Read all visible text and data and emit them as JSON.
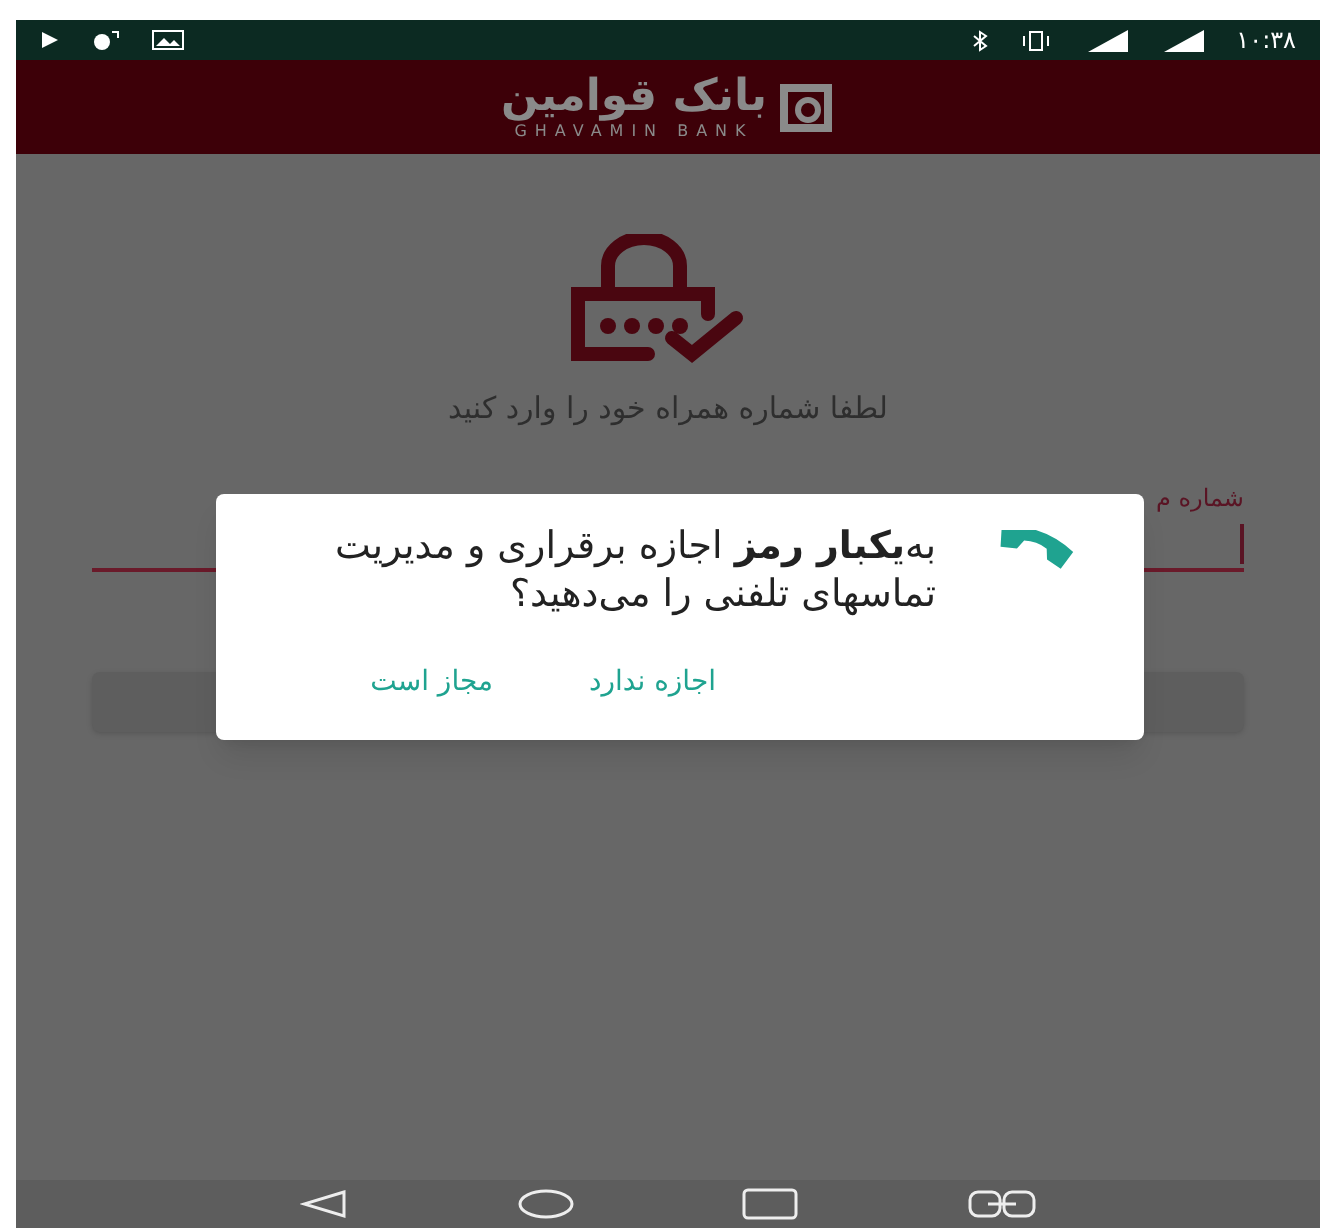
{
  "status_bar": {
    "time": "۱۰:۳۸"
  },
  "app_bar": {
    "logo_text": "بانک قوامین",
    "logo_subtitle": "GHAVAMIN BANK"
  },
  "login": {
    "prompt": "لطفا شماره همراه خود را وارد کنید",
    "field_label": "شماره م"
  },
  "dialog": {
    "message": "به‌**یکبار رمز** اجازه برقراری و مدیریت تماسهای تلفنی را می‌دهید؟",
    "buttons": [
      {
        "label": "اجازه ندارد"
      },
      {
        "label": "مجاز است"
      }
    ]
  }
}
